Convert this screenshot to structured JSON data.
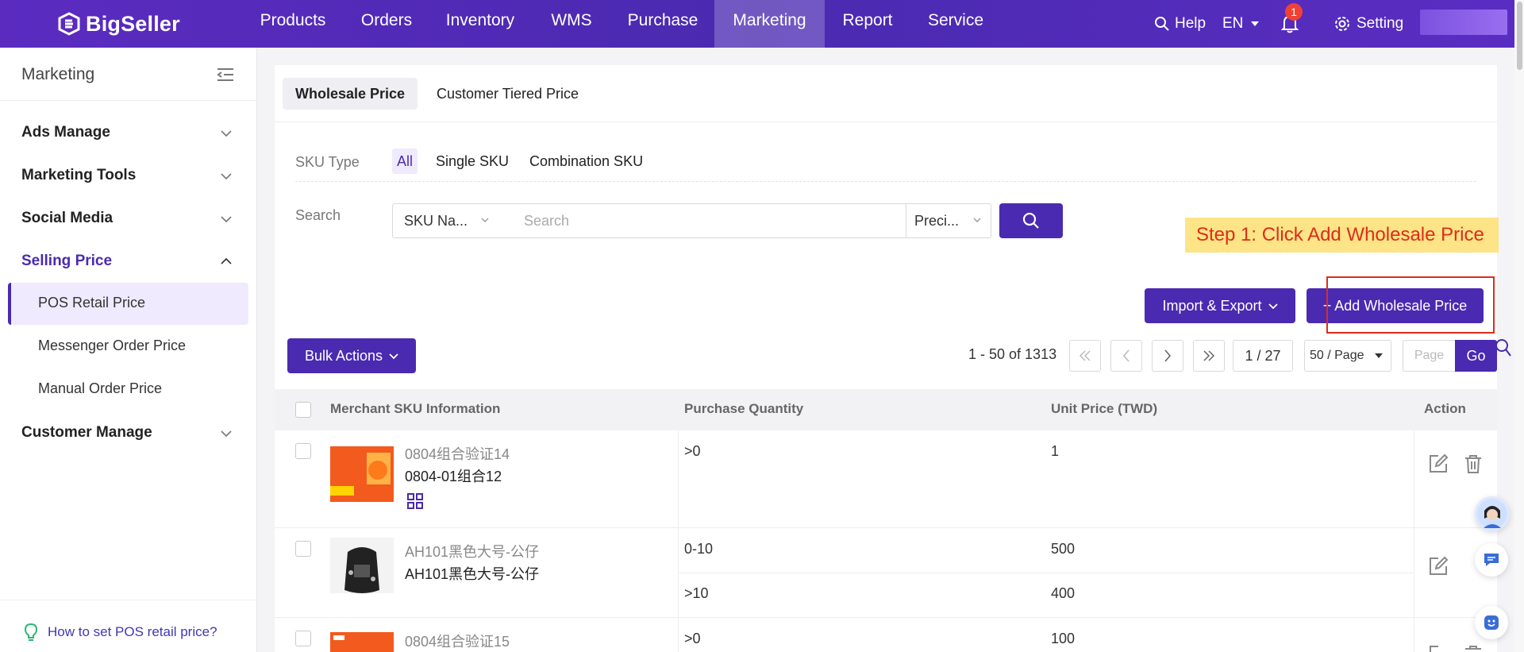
{
  "brand": {
    "logo_text": "BigSeller"
  },
  "nav": {
    "items": [
      {
        "label": "Products"
      },
      {
        "label": "Orders"
      },
      {
        "label": "Inventory"
      },
      {
        "label": "WMS"
      },
      {
        "label": "Purchase"
      },
      {
        "label": "Marketing",
        "active": true
      },
      {
        "label": "Report"
      },
      {
        "label": "Service"
      }
    ],
    "help_label": "Help",
    "language": "EN",
    "notification_count": "1",
    "setting_label": "Setting"
  },
  "sidebar": {
    "title": "Marketing",
    "groups": [
      {
        "label": "Ads Manage"
      },
      {
        "label": "Marketing Tools"
      },
      {
        "label": "Social Media"
      },
      {
        "label": "Selling Price",
        "open": true
      },
      {
        "label": "Customer Manage"
      }
    ],
    "sub_items": [
      {
        "label": "POS Retail Price",
        "active": true
      },
      {
        "label": "Messenger Order Price"
      },
      {
        "label": "Manual Order Price"
      }
    ],
    "help_link": "How to set POS retail price?"
  },
  "tabs": [
    {
      "label": "Wholesale Price",
      "active": true
    },
    {
      "label": "Customer Tiered Price"
    }
  ],
  "filters": {
    "sku_type_label": "SKU Type",
    "sku_type_options": [
      "All",
      "Single SKU",
      "Combination SKU"
    ],
    "search_label": "Search",
    "search_field_select": "SKU Na...",
    "search_placeholder": "Search",
    "match_select": "Preci..."
  },
  "annotation": {
    "callout": "Step 1: Click Add Wholesale Price"
  },
  "actions": {
    "import_export": "Import & Export",
    "add_wholesale": "+ Add Wholesale Price",
    "bulk_actions": "Bulk Actions"
  },
  "pagination": {
    "range_text": "1 - 50 of 1313",
    "page_indicator": "1 / 27",
    "page_size": "50 / Page",
    "page_input_placeholder": "Page",
    "go_label": "Go"
  },
  "table": {
    "columns": [
      "Merchant SKU Information",
      "Purchase Quantity",
      "Unit Price (TWD)",
      "Action"
    ],
    "rows": [
      {
        "sku_name": "0804组合验证14",
        "sku_code": "0804-01组合12",
        "tiers": [
          {
            "qty": ">0",
            "price": "1"
          }
        ],
        "has_combo_icon": true,
        "has_delete": true
      },
      {
        "sku_name": "AH101黑色大号-公仔",
        "sku_code": "AH101黑色大号-公仔",
        "tiers": [
          {
            "qty": "0-10",
            "price": "500"
          },
          {
            "qty": ">10",
            "price": "400"
          }
        ],
        "has_combo_icon": false,
        "has_delete": false
      },
      {
        "sku_name": "0804组合验证15",
        "sku_code": "",
        "tiers": [
          {
            "qty": ">0",
            "price": "100"
          }
        ],
        "has_combo_icon": false,
        "has_delete": true
      }
    ]
  },
  "colors": {
    "primary": "#4a2ab0",
    "nav_bg": "#5b2bc0",
    "annotation_red": "#e02b1a",
    "annotation_yellow": "#fde486"
  }
}
